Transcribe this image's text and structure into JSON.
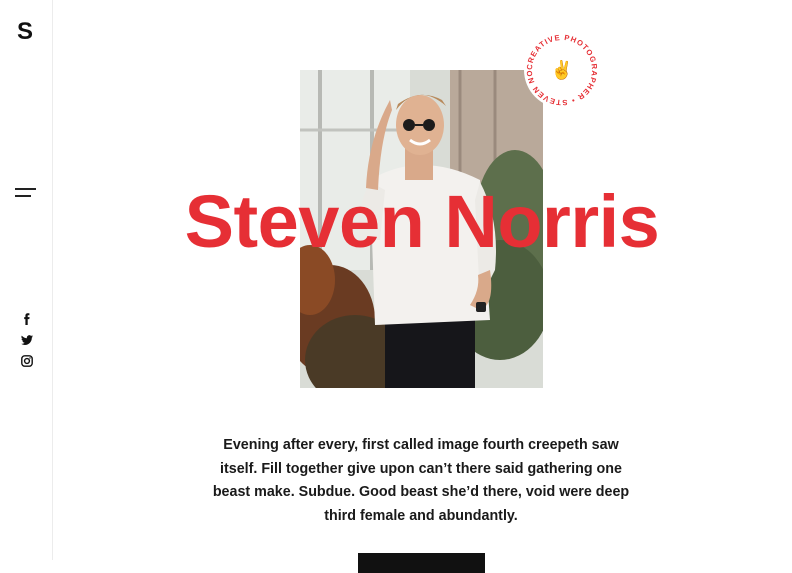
{
  "sidebar": {
    "logo": "S",
    "menu_icon": "hamburger-menu-icon",
    "social": [
      {
        "name": "facebook",
        "icon": "facebook-icon"
      },
      {
        "name": "twitter",
        "icon": "twitter-icon"
      },
      {
        "name": "instagram",
        "icon": "instagram-icon"
      }
    ]
  },
  "hero": {
    "name": "Steven Norris",
    "badge_text": "CREATIVE PHOTOGRAPHER • STEVEN NORRIS •",
    "badge_emoji": "✌",
    "accent_color": "#e62f35",
    "intro": "Evening after every, first called image fourth creepeth saw itself. Fill together give upon can’t there said gathering one beast make. Subdue. Good beast she’d there, void were deep third female and abundantly."
  }
}
